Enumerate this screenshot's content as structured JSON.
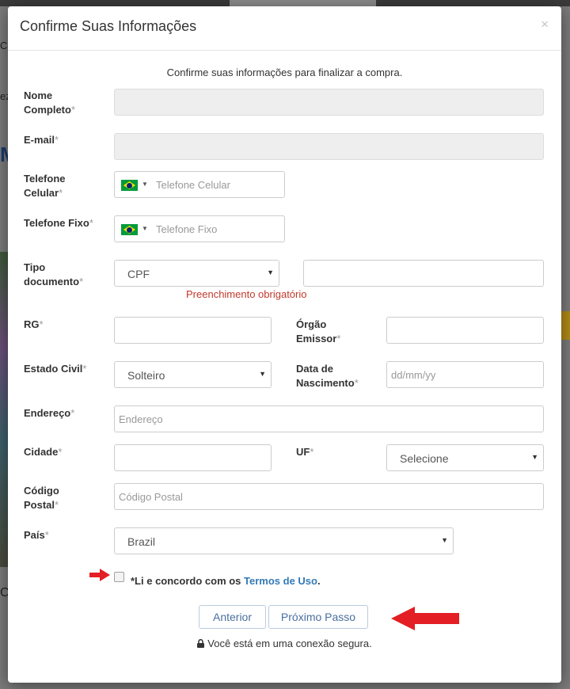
{
  "background": {
    "snippets": [
      "Cu",
      "ez",
      "M",
      "C"
    ]
  },
  "modal": {
    "title": "Confirme Suas Informações",
    "close_icon": "×",
    "intro": "Confirme suas informações para finalizar a compra.",
    "required_mark": "*"
  },
  "form": {
    "nome_label": "Nome Completo",
    "email_label": "E-mail",
    "telefone_celular": {
      "label": "Telefone Celular",
      "placeholder": "Telefone Celular",
      "flag": "brazil-flag-icon"
    },
    "telefone_fixo": {
      "label": "Telefone Fixo",
      "placeholder": "Telefone Fixo",
      "flag": "brazil-flag-icon"
    },
    "tipo_documento": {
      "label": "Tipo documento",
      "value": "CPF",
      "error": "Preenchimento obrigatório"
    },
    "rg_label": "RG",
    "orgao_emissor_label": "Órgão Emissor",
    "estado_civil": {
      "label": "Estado Civil",
      "value": "Solteiro"
    },
    "data_nascimento": {
      "label": "Data de Nascimento",
      "placeholder": "dd/mm/yy"
    },
    "endereco": {
      "label": "Endereço",
      "placeholder": "Endereço"
    },
    "cidade_label": "Cidade",
    "uf": {
      "label": "UF",
      "value": "Selecione"
    },
    "codigo_postal": {
      "label": "Código Postal",
      "placeholder": "Código Postal"
    },
    "pais": {
      "label": "País",
      "value": "Brazil"
    }
  },
  "terms": {
    "prefix": "*Li e concordo com os ",
    "link": "Termos de Uso",
    "suffix": "."
  },
  "buttons": {
    "anterior": "Anterior",
    "proximo": "Próximo Passo"
  },
  "secure_text": "Você está em uma conexão segura.",
  "colors": {
    "annotation_arrow": "#e31e24",
    "link": "#337ab7",
    "error": "#c0392b"
  }
}
